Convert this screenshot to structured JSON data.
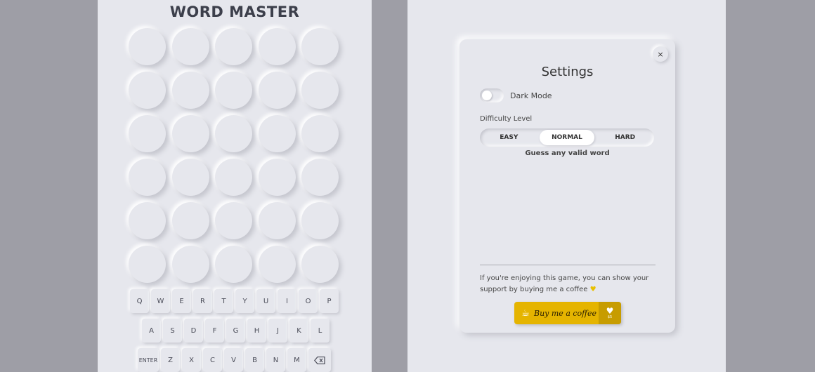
{
  "game": {
    "title": "WORD MASTER",
    "grid_rows": 6,
    "grid_cols": 5,
    "keyboard": {
      "row1": [
        "Q",
        "W",
        "E",
        "R",
        "T",
        "Y",
        "U",
        "I",
        "O",
        "P"
      ],
      "row2": [
        "A",
        "S",
        "D",
        "F",
        "G",
        "H",
        "J",
        "K",
        "L"
      ],
      "row3": [
        "ENTER",
        "Z",
        "X",
        "C",
        "V",
        "B",
        "N",
        "M"
      ],
      "backspace_icon": "backspace-icon"
    }
  },
  "settings": {
    "title": "Settings",
    "close_label": "×",
    "dark_mode_label": "Dark Mode",
    "dark_mode_on": false,
    "difficulty_label": "Difficulty Level",
    "difficulty_options": [
      "EASY",
      "NORMAL",
      "HARD"
    ],
    "difficulty_selected": "NORMAL",
    "difficulty_description": "Guess any valid word",
    "support_text": "If you're enjoying this game, you can show your support by buying me a coffee",
    "support_heart": "♥",
    "coffee_button": {
      "label": "Buy me a coffee",
      "cup_icon": "☕",
      "heart_icon": "♥",
      "amount": "$5"
    }
  },
  "colors": {
    "background_outer": "#9e9ea6",
    "panel": "#e6e7ed",
    "coffee_yellow": "#e5b400"
  }
}
